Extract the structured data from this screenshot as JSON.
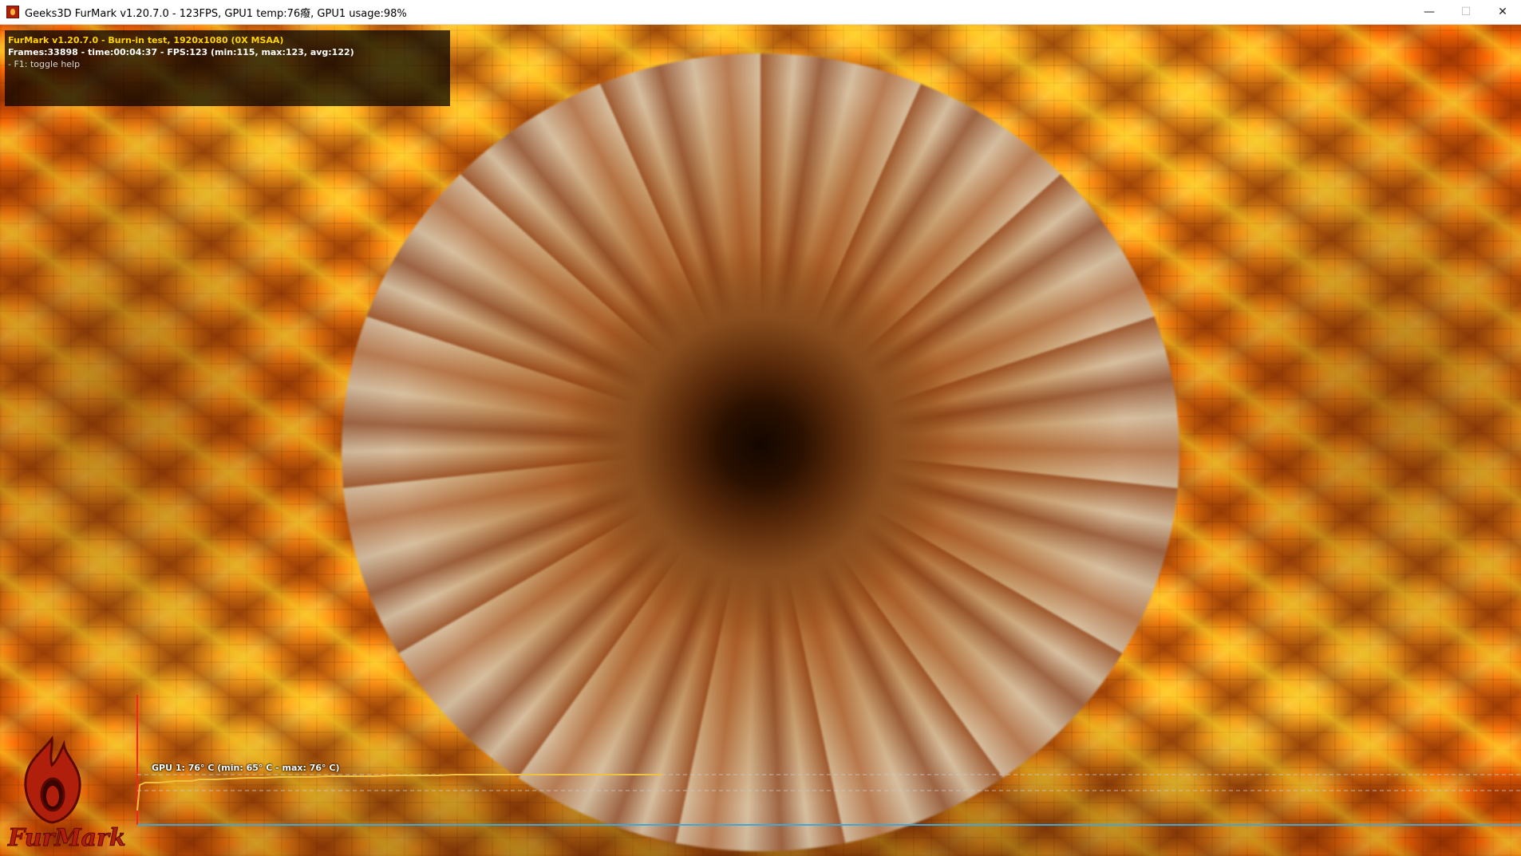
{
  "window": {
    "title": "Geeks3D FurMark v1.20.7.0 - 123FPS, GPU1 temp:76癈, GPU1 usage:98%",
    "controls": {
      "minimize": "—",
      "maximize": "☐",
      "close": "✕"
    }
  },
  "hud": {
    "line1": "FurMark v1.20.7.0 - Burn-in test, 1920x1080 (0X MSAA)",
    "line2": "Frames:33898 - time:00:04:37 - FPS:123 (min:115, max:123, avg:122)",
    "line3": "- F1: toggle help"
  },
  "temperature_graph": {
    "label": "GPU 1: 76° C (min: 65° C - max: 76° C)",
    "current": 76,
    "min": 65,
    "max": 76,
    "line_color": "#f0c040",
    "axis_color_y": "#ff2020",
    "axis_color_x": "#40a8d8"
  },
  "logo": {
    "text": "FurMark",
    "color": "#b01e0c"
  },
  "icons": {
    "app": "furmark-flame-icon"
  }
}
